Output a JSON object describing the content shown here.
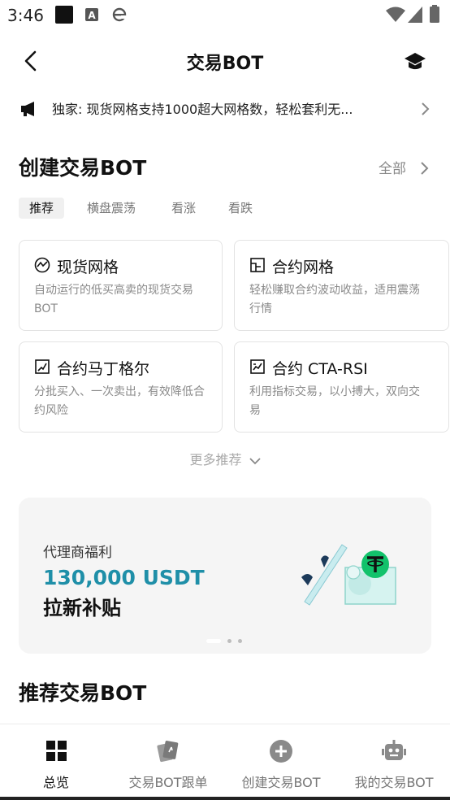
{
  "status_bar": {
    "time": "3:46"
  },
  "header": {
    "title": "交易BOT"
  },
  "notice": {
    "text": "独家: 现货网格支持1000超大网格数，轻松套利无..."
  },
  "create_section": {
    "title": "创建交易BOT",
    "all_label": "全部",
    "tabs": [
      {
        "label": "推荐",
        "active": true
      },
      {
        "label": "横盘震荡",
        "active": false
      },
      {
        "label": "看涨",
        "active": false
      },
      {
        "label": "看跌",
        "active": false
      }
    ],
    "cards": [
      {
        "title": "现货网格",
        "desc": "自动运行的低买高卖的现货交易BOT",
        "icon": "spot-grid-icon"
      },
      {
        "title": "合约网格",
        "desc": "轻松赚取合约波动收益，适用震荡行情",
        "icon": "contract-grid-icon"
      },
      {
        "title": "合约马丁格尔",
        "desc": "分批买入、一次卖出，有效降低合约风险",
        "icon": "martingale-icon"
      },
      {
        "title": "合约 CTA-RSI",
        "desc": "利用指标交易，以小搏大，双向交易",
        "icon": "cta-rsi-icon"
      }
    ],
    "more_label": "更多推荐"
  },
  "banner": {
    "subtitle": "代理商福利",
    "amount": "130,000 USDT",
    "text": "拉新补贴",
    "accent_color": "#1f8fa8",
    "active_slide": 1,
    "slide_count": 3
  },
  "recommended": {
    "title": "推荐交易BOT"
  },
  "bottom_nav": [
    {
      "label": "总览",
      "icon": "overview-grid-icon",
      "active": true
    },
    {
      "label": "交易BOT跟单",
      "icon": "copy-trade-cards-icon",
      "active": false
    },
    {
      "label": "创建交易BOT",
      "icon": "plus-circle-icon",
      "active": false
    },
    {
      "label": "我的交易BOT",
      "icon": "robot-icon",
      "active": false
    }
  ]
}
